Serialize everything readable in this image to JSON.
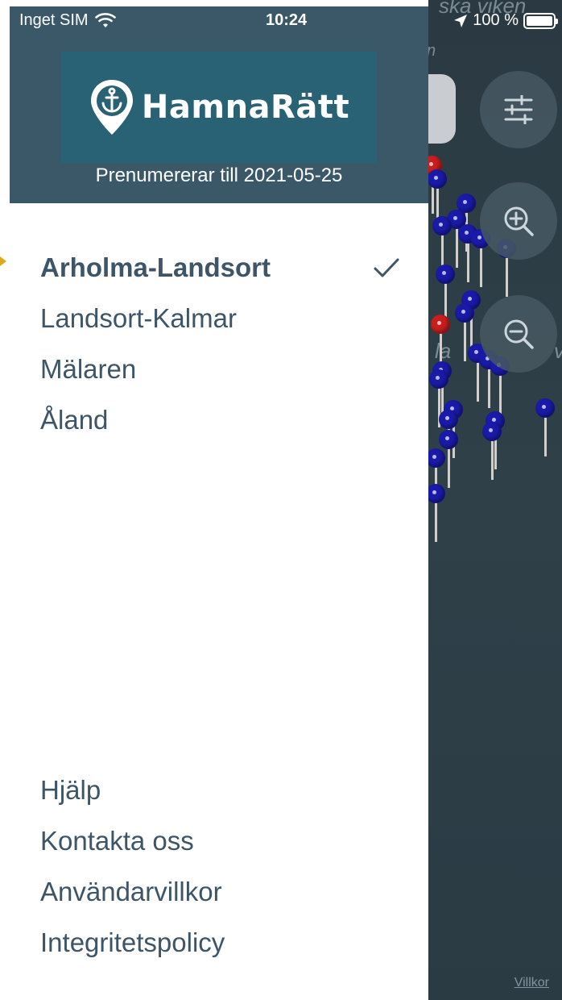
{
  "status_bar": {
    "carrier": "Inget SIM",
    "time": "10:24",
    "battery": "100 %",
    "icons": [
      "wifi-icon",
      "location-arrow-icon",
      "battery-icon"
    ]
  },
  "drawer": {
    "logo_text": "HamnaRätt",
    "subscription": "Prenumererar till 2021-05-25",
    "regions": [
      {
        "label": "Arholma-Landsort",
        "selected": true
      },
      {
        "label": "Landsort-Kalmar",
        "selected": false
      },
      {
        "label": "Mälaren",
        "selected": false
      },
      {
        "label": "Åland",
        "selected": false
      }
    ],
    "footer_links": [
      "Hjälp",
      "Kontakta oss",
      "Användarvillkor",
      "Integritetspolicy"
    ]
  },
  "map": {
    "visible_text": [
      "ska viken",
      "n",
      "la",
      "v"
    ],
    "terms_link": "Villkor",
    "buttons": [
      "filter-sliders-icon",
      "zoom-in-icon",
      "zoom-out-icon"
    ],
    "colors": {
      "pin_blue": "#1a1aa8",
      "pin_red": "#c81e1e",
      "header": "#3a5868",
      "menu_text": "#3d5567"
    }
  }
}
